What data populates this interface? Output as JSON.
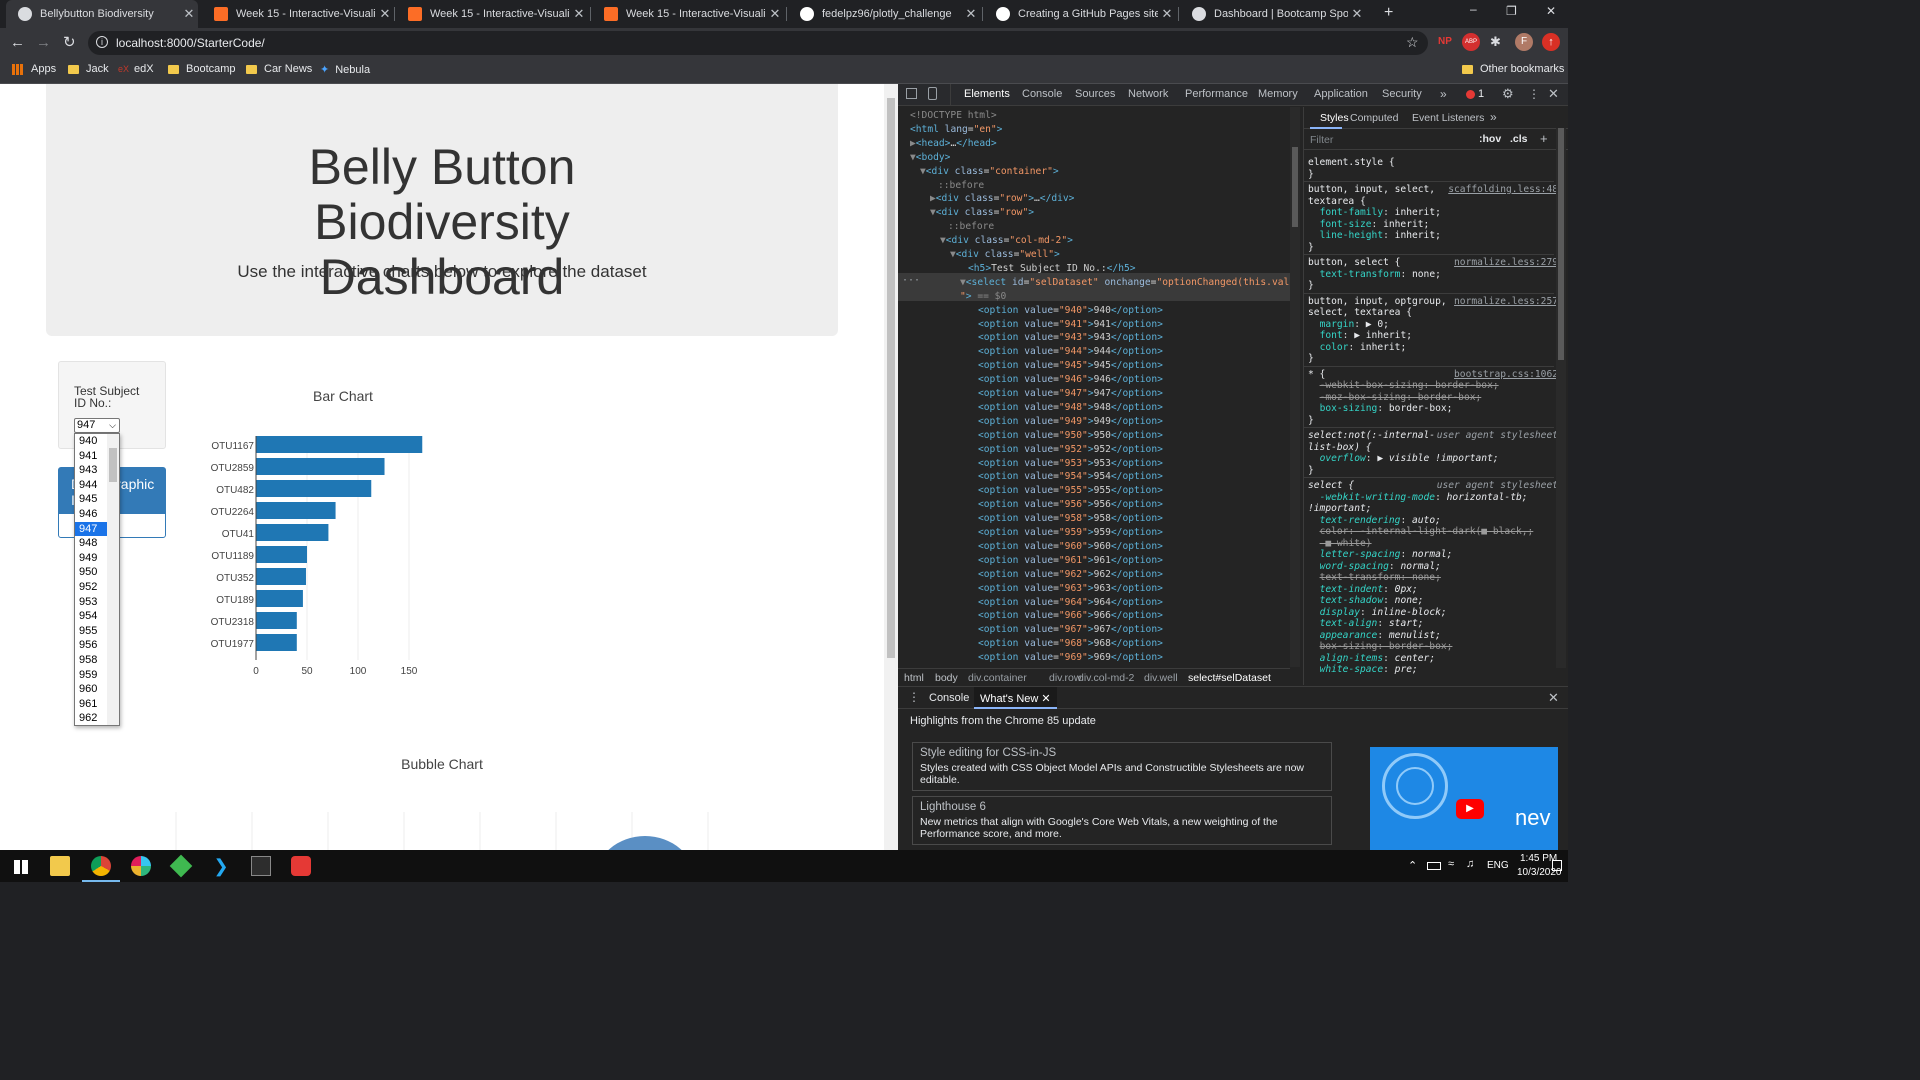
{
  "tabs": [
    {
      "title": "Bellybutton Biodiversity",
      "active": true,
      "icon": "globe-icon"
    },
    {
      "title": "Week 15 - Interactive-Visualizatio",
      "icon": "gitlab-icon"
    },
    {
      "title": "Week 15 - Interactive-Visualizatio",
      "icon": "gitlab-icon"
    },
    {
      "title": "Week 15 - Interactive-Visualizatio",
      "icon": "gitlab-icon"
    },
    {
      "title": "fedelpz96/plotly_challenge",
      "icon": "github-icon"
    },
    {
      "title": "Creating a GitHub Pages site - Gi",
      "icon": "github-icon"
    },
    {
      "title": "Dashboard | Bootcamp Spot",
      "icon": "globe-icon"
    }
  ],
  "url": "localhost:8000/StarterCode/",
  "bookmarks": [
    "Apps",
    "Jack",
    "edX",
    "Bootcamp",
    "Car News",
    "Nebula"
  ],
  "other_bookmarks": "Other bookmarks",
  "page": {
    "title": "Belly Button Biodiversity Dashboard",
    "subtitle": "Use the interactive charts below to explore the dataset",
    "select_label": "Test Subject ID No.:",
    "selected": "947",
    "options": [
      "940",
      "941",
      "943",
      "944",
      "945",
      "946",
      "947",
      "948",
      "949",
      "950",
      "952",
      "953",
      "954",
      "955",
      "956",
      "958",
      "959",
      "960",
      "961",
      "962"
    ],
    "panel_heading": "Demographic Info",
    "bubble_title": "Bubble Chart"
  },
  "chart_data": {
    "type": "bar",
    "title": "Bar Chart",
    "orientation": "horizontal",
    "categories": [
      "OTU1167",
      "OTU2859",
      "OTU482",
      "OTU2264",
      "OTU41",
      "OTU1189",
      "OTU352",
      "OTU189",
      "OTU2318",
      "OTU1977"
    ],
    "values": [
      163,
      126,
      113,
      78,
      71,
      50,
      49,
      46,
      40,
      40
    ],
    "xticks": [
      0,
      50,
      100,
      150
    ],
    "xlim": [
      0,
      175
    ],
    "color": "#1f77b4"
  },
  "devtools": {
    "tabs": [
      "Elements",
      "Console",
      "Sources",
      "Network",
      "Performance",
      "Memory",
      "Application",
      "Security"
    ],
    "error_count": "1",
    "style_tabs": [
      "Styles",
      "Computed",
      "Event Listeners"
    ],
    "filter_placeholder": "Filter",
    "hov": ":hov",
    "cls": ".cls",
    "crumbs": [
      "html",
      "body",
      "div.container",
      "div.row",
      "div.col-md-2",
      "div.well",
      "select#selDataset"
    ],
    "drawer_tabs": [
      "Console",
      "What's New"
    ],
    "highlights": "Highlights from the Chrome 85 update",
    "cards": [
      {
        "title": "Style editing for CSS-in-JS",
        "body": "Styles created with CSS Object Model APIs and Constructible Stylesheets are now editable."
      },
      {
        "title": "Lighthouse 6",
        "body": "New metrics that align with Google's Core Web Vitals, a new weighting of the Performance score, and more."
      }
    ],
    "video_text": "nev"
  },
  "taskbar": {
    "time": "1:45 PM",
    "date": "10/3/2020",
    "lang": "ENG"
  }
}
